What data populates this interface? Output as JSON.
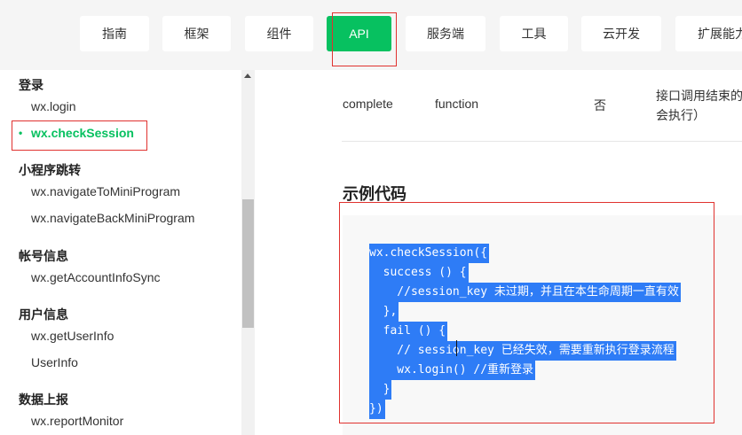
{
  "topnav": {
    "tabs": [
      {
        "label": "指南",
        "active": false
      },
      {
        "label": "框架",
        "active": false
      },
      {
        "label": "组件",
        "active": false
      },
      {
        "label": "API",
        "active": true
      },
      {
        "label": "服务端",
        "active": false
      },
      {
        "label": "工具",
        "active": false
      },
      {
        "label": "云开发",
        "active": false
      },
      {
        "label": "扩展能力",
        "active": false
      }
    ],
    "active_color": "#07c160"
  },
  "sidebar": {
    "groups": [
      {
        "heading": "登录",
        "items": [
          "wx.login",
          "wx.checkSession"
        ]
      },
      {
        "heading": "小程序跳转",
        "items": [
          "wx.navigateToMiniProgram",
          "wx.navigateBackMiniProgram"
        ]
      },
      {
        "heading": "帐号信息",
        "items": [
          "wx.getAccountInfoSync"
        ]
      },
      {
        "heading": "用户信息",
        "items": [
          "wx.getUserInfo",
          "UserInfo"
        ]
      },
      {
        "heading": "数据上报",
        "items": [
          "wx.reportMonitor"
        ]
      }
    ],
    "active_item": "wx.checkSession",
    "bullet": "•"
  },
  "param_row": {
    "name": "complete",
    "type": "function",
    "required": "否",
    "desc_line1": "接口调用结束的",
    "desc_line2": "会执行）"
  },
  "example": {
    "title": "示例代码",
    "code_lines": [
      "wx.checkSession({",
      "  success () {",
      "    //session_key 未过期，并且在本生命周期一直有效",
      "  },",
      "  fail () {",
      "    // session_key 已经失效，需要重新执行登录流程",
      "    wx.login() //重新登录",
      "  }",
      "})"
    ]
  },
  "colors": {
    "accent": "#07c160",
    "highlight_box": "#e0322f",
    "selection": "#2e7cf6"
  }
}
